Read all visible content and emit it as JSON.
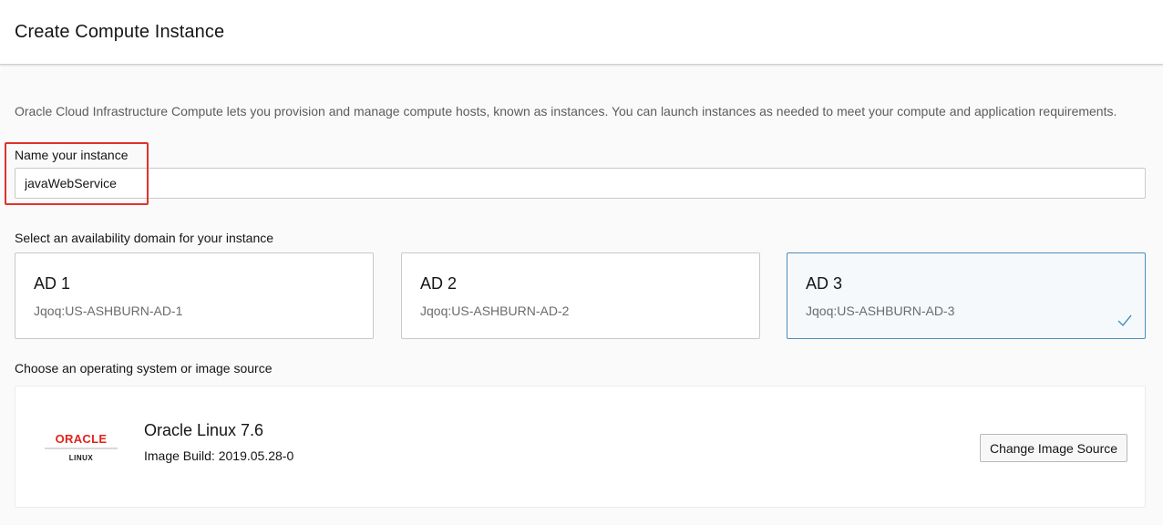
{
  "header": {
    "title": "Create Compute Instance"
  },
  "intro": {
    "text": "Oracle Cloud Infrastructure Compute lets you provision and manage compute hosts, known as instances. You can launch instances as needed to meet your compute and application requirements."
  },
  "name_section": {
    "label": "Name your instance",
    "value": "javaWebService"
  },
  "availability": {
    "label": "Select an availability domain for your instance",
    "domains": [
      {
        "title": "AD 1",
        "subtitle": "Jqoq:US-ASHBURN-AD-1",
        "selected": false
      },
      {
        "title": "AD 2",
        "subtitle": "Jqoq:US-ASHBURN-AD-2",
        "selected": false
      },
      {
        "title": "AD 3",
        "subtitle": "Jqoq:US-ASHBURN-AD-3",
        "selected": true
      }
    ]
  },
  "image_source": {
    "label": "Choose an operating system or image source",
    "logo_text": "ORACLE",
    "logo_subtext": "LINUX",
    "os_name": "Oracle Linux 7.6",
    "build": "Image Build: 2019.05.28-0",
    "change_button": "Change Image Source"
  },
  "colors": {
    "highlight": "#e0332b",
    "selected_border": "#4b8fb8",
    "oracle_red": "#e2231a"
  },
  "icons": {
    "check": "checkmark-icon"
  }
}
